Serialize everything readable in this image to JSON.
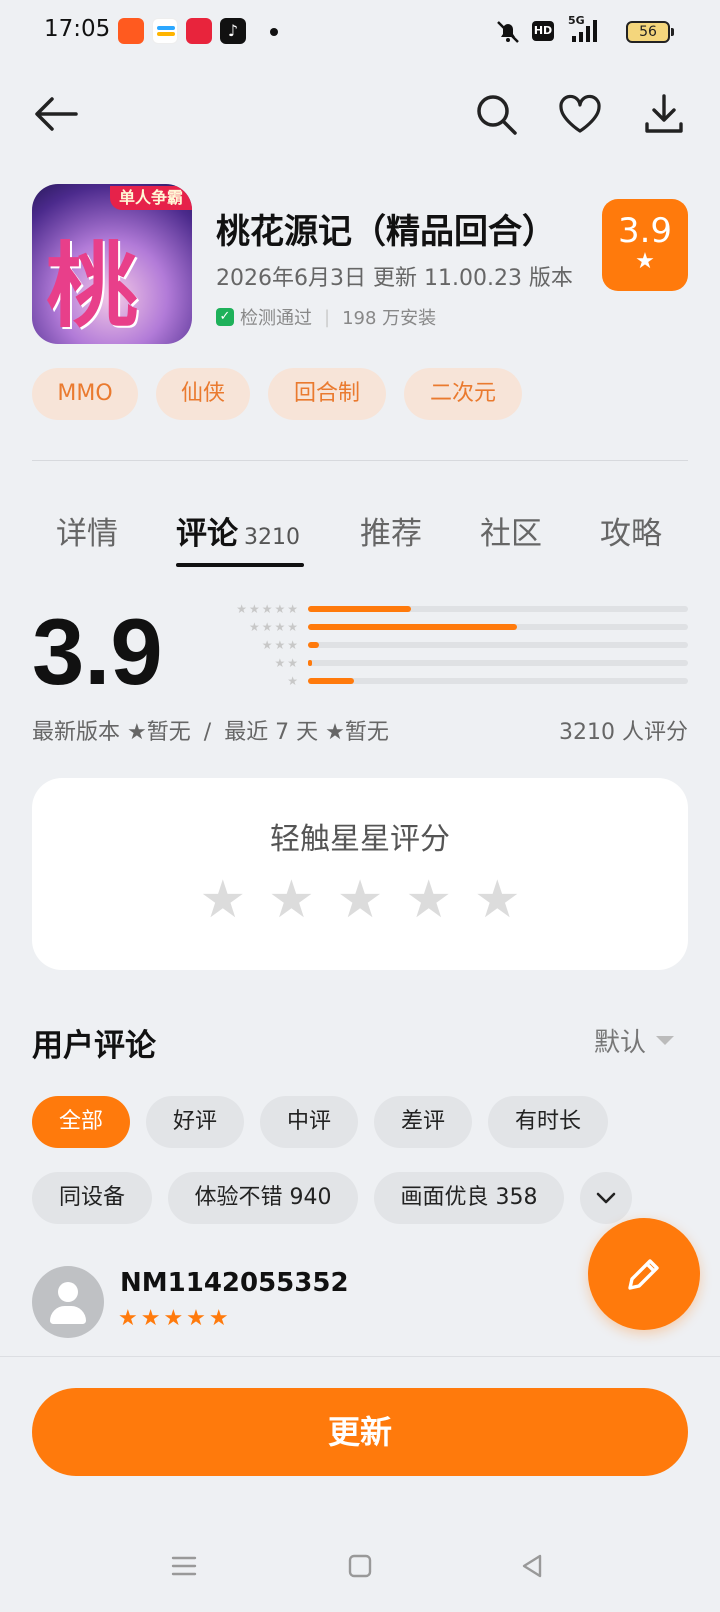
{
  "status_bar": {
    "time": "17:05",
    "network": "5G",
    "hd": "HD",
    "battery": "56"
  },
  "header": {
    "back": "back-arrow-icon",
    "search": "search-icon",
    "favorite": "heart-icon",
    "download": "download-icon"
  },
  "app": {
    "title": "桃花源记（精品回合）",
    "icon_banner": "单人争霸",
    "icon_art": "桃花",
    "meta": "2026年6月3日 更新 11.00.23 版本",
    "verified": "检测通过",
    "installs": "198 万安装",
    "rating": "3.9",
    "tags": [
      "MMO",
      "仙侠",
      "回合制",
      "二次元"
    ]
  },
  "tabs": [
    {
      "label": "详情"
    },
    {
      "label": "评论",
      "count": "3210"
    },
    {
      "label": "推荐"
    },
    {
      "label": "社区"
    },
    {
      "label": "攻略"
    }
  ],
  "rating_summary": {
    "score": "3.9",
    "distribution": [
      {
        "stars": 5,
        "fraction": 0.27
      },
      {
        "stars": 4,
        "fraction": 0.55
      },
      {
        "stars": 3,
        "fraction": 0.03
      },
      {
        "stars": 2,
        "fraction": 0.01
      },
      {
        "stars": 1,
        "fraction": 0.12
      }
    ],
    "latest_version_label": "最新版本",
    "latest_version_value": "暂无",
    "recent_label": "最近 7 天",
    "recent_value": "暂无",
    "slash": "/",
    "count": "3210 人评分"
  },
  "rate_card": {
    "title": "轻触星星评分",
    "stars": 5
  },
  "reviews": {
    "title": "用户评论",
    "sort": "默认",
    "filters_row1": [
      "全部",
      "好评",
      "中评",
      "差评",
      "有时长"
    ],
    "filters_row2": [
      "同设备",
      "体验不错 940",
      "画面优良 358"
    ],
    "first_review": {
      "user": "NM1142055352",
      "rating": 5
    }
  },
  "bottom": {
    "update_label": "更新"
  },
  "colors": {
    "accent": "#ff7a0c",
    "tag_bg": "#f7e4d8",
    "tag_text": "#ea7a2f",
    "background": "#eef0f3"
  }
}
